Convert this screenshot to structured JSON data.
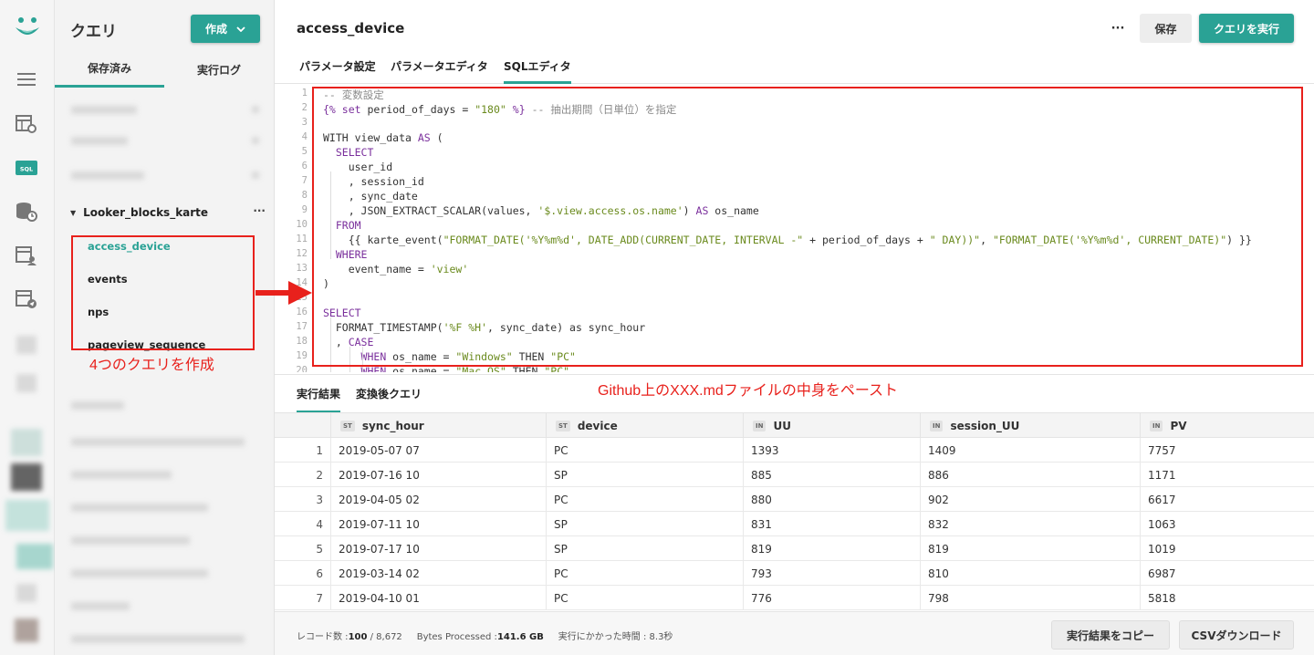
{
  "sidebar": {
    "title": "クエリ",
    "create_label": "作成",
    "tabs": [
      "保存済み",
      "実行ログ"
    ],
    "folder": "Looker_blocks_karte",
    "folder_more": "···",
    "queries": [
      "access_device",
      "events",
      "nps",
      "pageview_sequence"
    ]
  },
  "header": {
    "title": "access_device",
    "more": "···",
    "save_label": "保存",
    "run_label": "クエリを実行"
  },
  "editor_tabs": [
    "パラメータ設定",
    "パラメータエディタ",
    "SQLエディタ"
  ],
  "editor": {
    "line_numbers": [
      "1",
      "2",
      "3",
      "4",
      "5",
      "6",
      "7",
      "8",
      "9",
      "10",
      "11",
      "12",
      "13",
      "14",
      "15",
      "16",
      "17",
      "18",
      "19",
      "20"
    ],
    "lines": [
      "-- 変数設定",
      "{% set period_of_days = \"180\" %} -- 抽出期間（日単位）を指定",
      "",
      "WITH view_data AS (",
      "  SELECT",
      "    user_id",
      "    , session_id",
      "    , sync_date",
      "    , JSON_EXTRACT_SCALAR(values, '$.view.access.os.name') AS os_name",
      "  FROM",
      "    {{ karte_event(\"FORMAT_DATE('%Y%m%d', DATE_ADD(CURRENT_DATE, INTERVAL -\" + period_of_days + \" DAY))\", \"FORMAT_DATE('%Y%m%d', CURRENT_DATE)\") }}",
      "  WHERE",
      "    event_name = 'view'",
      ")",
      "",
      "SELECT",
      "  FORMAT_TIMESTAMP('%F %H', sync_date) as sync_hour",
      "  , CASE",
      "      WHEN os_name = \"Windows\" THEN \"PC\"",
      "      WHEN os_name = \"Mac OS\" THEN \"PC\""
    ]
  },
  "result_tabs": [
    "実行結果",
    "変換後クエリ"
  ],
  "table": {
    "columns": [
      {
        "type": "ST",
        "name": "sync_hour"
      },
      {
        "type": "ST",
        "name": "device"
      },
      {
        "type": "IN",
        "name": "UU"
      },
      {
        "type": "IN",
        "name": "session_UU"
      },
      {
        "type": "IN",
        "name": "PV"
      }
    ],
    "rows": [
      [
        "1",
        "2019-05-07 07",
        "PC",
        "1393",
        "1409",
        "7757"
      ],
      [
        "2",
        "2019-07-16 10",
        "SP",
        "885",
        "886",
        "1171"
      ],
      [
        "3",
        "2019-04-05 02",
        "PC",
        "880",
        "902",
        "6617"
      ],
      [
        "4",
        "2019-07-11 10",
        "SP",
        "831",
        "832",
        "1063"
      ],
      [
        "5",
        "2019-07-17 10",
        "SP",
        "819",
        "819",
        "1019"
      ],
      [
        "6",
        "2019-03-14 02",
        "PC",
        "793",
        "810",
        "6987"
      ],
      [
        "7",
        "2019-04-10 01",
        "PC",
        "776",
        "798",
        "5818"
      ]
    ]
  },
  "footer": {
    "records_label": "レコード数 :",
    "records_value": "100",
    "records_total": " / 8,672",
    "bytes_label": "Bytes Processed :",
    "bytes_value": "141.6 GB",
    "time_label": "実行にかかった時間 : 8.3秒",
    "copy_label": "実行結果をコピー",
    "csv_label": "CSVダウンロード"
  },
  "annotations": {
    "queries_note": "4つのクエリを作成",
    "editor_note": "Github上のXXX.mdファイルの中身をペースト"
  },
  "colors": {
    "accent": "#2aa295",
    "annotation": "#e8211c",
    "keyword": "#7a2f9c",
    "string": "#6a8a1d"
  }
}
